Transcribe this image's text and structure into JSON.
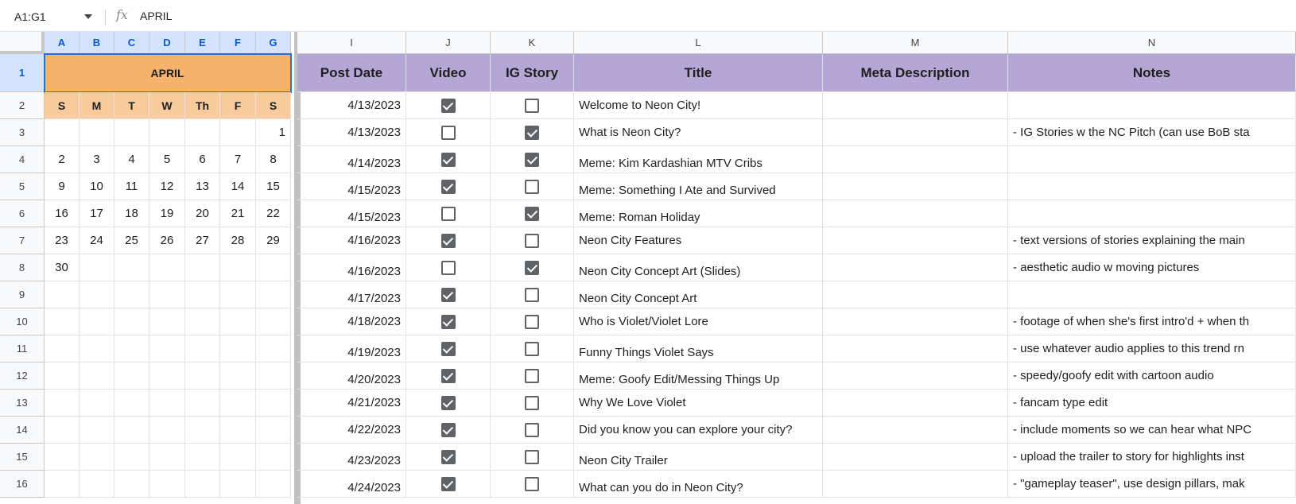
{
  "name_box": "A1:G1",
  "formula_value": "APRIL",
  "columns_left": [
    "A",
    "B",
    "C",
    "D",
    "E",
    "F",
    "G"
  ],
  "columns_right": [
    "I",
    "J",
    "K",
    "L",
    "M",
    "N"
  ],
  "row_numbers": [
    "1",
    "2",
    "3",
    "4",
    "5",
    "6",
    "7",
    "8",
    "9",
    "10",
    "11",
    "12",
    "13",
    "14",
    "15",
    "16"
  ],
  "calendar": {
    "month": "APRIL",
    "weekdays": [
      "S",
      "M",
      "T",
      "W",
      "Th",
      "F",
      "S"
    ],
    "weeks": [
      [
        "",
        "",
        "",
        "",
        "",
        "",
        "1"
      ],
      [
        "2",
        "3",
        "4",
        "5",
        "6",
        "7",
        "8"
      ],
      [
        "9",
        "10",
        "11",
        "12",
        "13",
        "14",
        "15"
      ],
      [
        "16",
        "17",
        "18",
        "19",
        "20",
        "21",
        "22"
      ],
      [
        "23",
        "24",
        "25",
        "26",
        "27",
        "28",
        "29"
      ],
      [
        "30",
        "",
        "",
        "",
        "",
        "",
        ""
      ]
    ]
  },
  "table": {
    "headers": [
      "Post Date",
      "Video",
      "IG Story",
      "Title",
      "Meta Description",
      "Notes"
    ],
    "rows": [
      {
        "date": "4/13/2023",
        "video": true,
        "story": false,
        "title": "Welcome to Neon City!",
        "meta": "",
        "notes": ""
      },
      {
        "date": "4/13/2023",
        "video": false,
        "story": true,
        "title": "What is Neon City?",
        "meta": "",
        "notes": "- IG Stories w the NC Pitch (can use BoB sta"
      },
      {
        "date": "4/14/2023",
        "video": true,
        "story": true,
        "title": "Meme: Kim Kardashian MTV Cribs",
        "meta": "",
        "notes": ""
      },
      {
        "date": "4/15/2023",
        "video": true,
        "story": false,
        "title": "Meme: Something I Ate and Survived",
        "meta": "",
        "notes": ""
      },
      {
        "date": "4/15/2023",
        "video": false,
        "story": true,
        "title": "Meme: Roman Holiday",
        "meta": "",
        "notes": ""
      },
      {
        "date": "4/16/2023",
        "video": true,
        "story": false,
        "title": "Neon City Features",
        "meta": "",
        "notes": "- text versions of stories explaining the main"
      },
      {
        "date": "4/16/2023",
        "video": false,
        "story": true,
        "title": "Neon City Concept Art (Slides)",
        "meta": "",
        "notes": "- aesthetic audio w moving pictures"
      },
      {
        "date": "4/17/2023",
        "video": true,
        "story": false,
        "title": "Neon City Concept Art",
        "meta": "",
        "notes": ""
      },
      {
        "date": "4/18/2023",
        "video": true,
        "story": false,
        "title": "Who is Violet/Violet Lore",
        "meta": "",
        "notes": "- footage of when she's first intro'd + when th"
      },
      {
        "date": "4/19/2023",
        "video": true,
        "story": false,
        "title": "Funny Things Violet Says",
        "meta": "",
        "notes": "- use whatever audio applies to this trend rn"
      },
      {
        "date": "4/20/2023",
        "video": true,
        "story": false,
        "title": "Meme: Goofy Edit/Messing Things Up",
        "meta": "",
        "notes": "- speedy/goofy edit with cartoon audio"
      },
      {
        "date": "4/21/2023",
        "video": true,
        "story": false,
        "title": "Why We Love Violet",
        "meta": "",
        "notes": "- fancam type edit"
      },
      {
        "date": "4/22/2023",
        "video": true,
        "story": false,
        "title": "Did you know you can explore your city?",
        "meta": "",
        "notes": "- include moments so we can hear what NPC"
      },
      {
        "date": "4/23/2023",
        "video": true,
        "story": false,
        "title": "Neon City Trailer",
        "meta": "",
        "notes": "- upload the trailer to story for highlights inst"
      },
      {
        "date": "4/24/2023",
        "video": true,
        "story": false,
        "title": "What can you do in Neon City?",
        "meta": "",
        "notes": "- \"gameplay teaser\", use design pillars, mak"
      }
    ]
  },
  "colors": {
    "month_header": "#f6b26b",
    "weekday_header": "#f9cb9c",
    "table_header": "#b4a7d6",
    "selection": "#1a73e8"
  },
  "icons": [
    "fx-icon",
    "dropdown-icon",
    "checkbox-icon"
  ]
}
